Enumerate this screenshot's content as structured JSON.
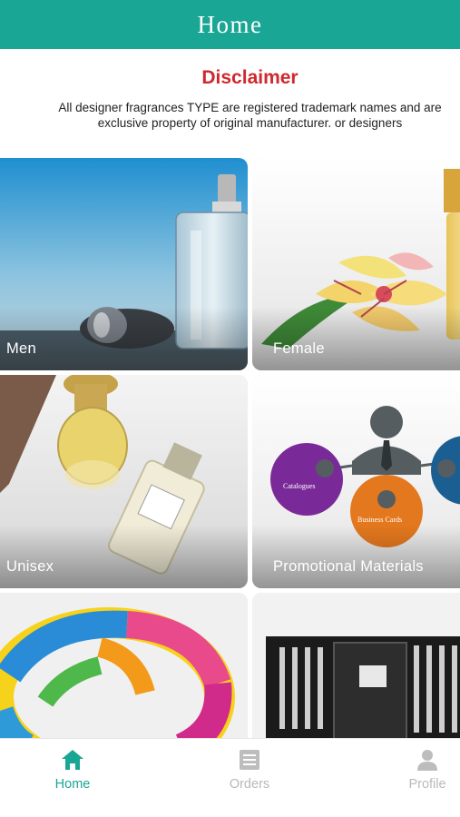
{
  "appbar": {
    "title": "Home"
  },
  "disclaimer": {
    "title": "Disclaimer",
    "line1": "All designer fragrances TYPE are registered trademark names and are",
    "line2": "exclusive property of original manufacturer. or designers"
  },
  "categories": [
    {
      "label": "Men"
    },
    {
      "label": "Female"
    },
    {
      "label": "Unisex"
    },
    {
      "label": "Promotional Materials",
      "diagram_labels": [
        "Catalogues",
        "Business Cards"
      ]
    },
    {
      "label": ""
    },
    {
      "label": ""
    }
  ],
  "bottom_nav": {
    "items": [
      {
        "label": "Home",
        "icon": "home-icon",
        "active": true
      },
      {
        "label": "Orders",
        "icon": "orders-icon",
        "active": false
      },
      {
        "label": "Profile",
        "icon": "profile-icon",
        "active": false
      }
    ]
  },
  "colors": {
    "accent": "#1aa694",
    "disclaimer_title": "#d0282e",
    "inactive_nav": "#b9b9b9"
  }
}
